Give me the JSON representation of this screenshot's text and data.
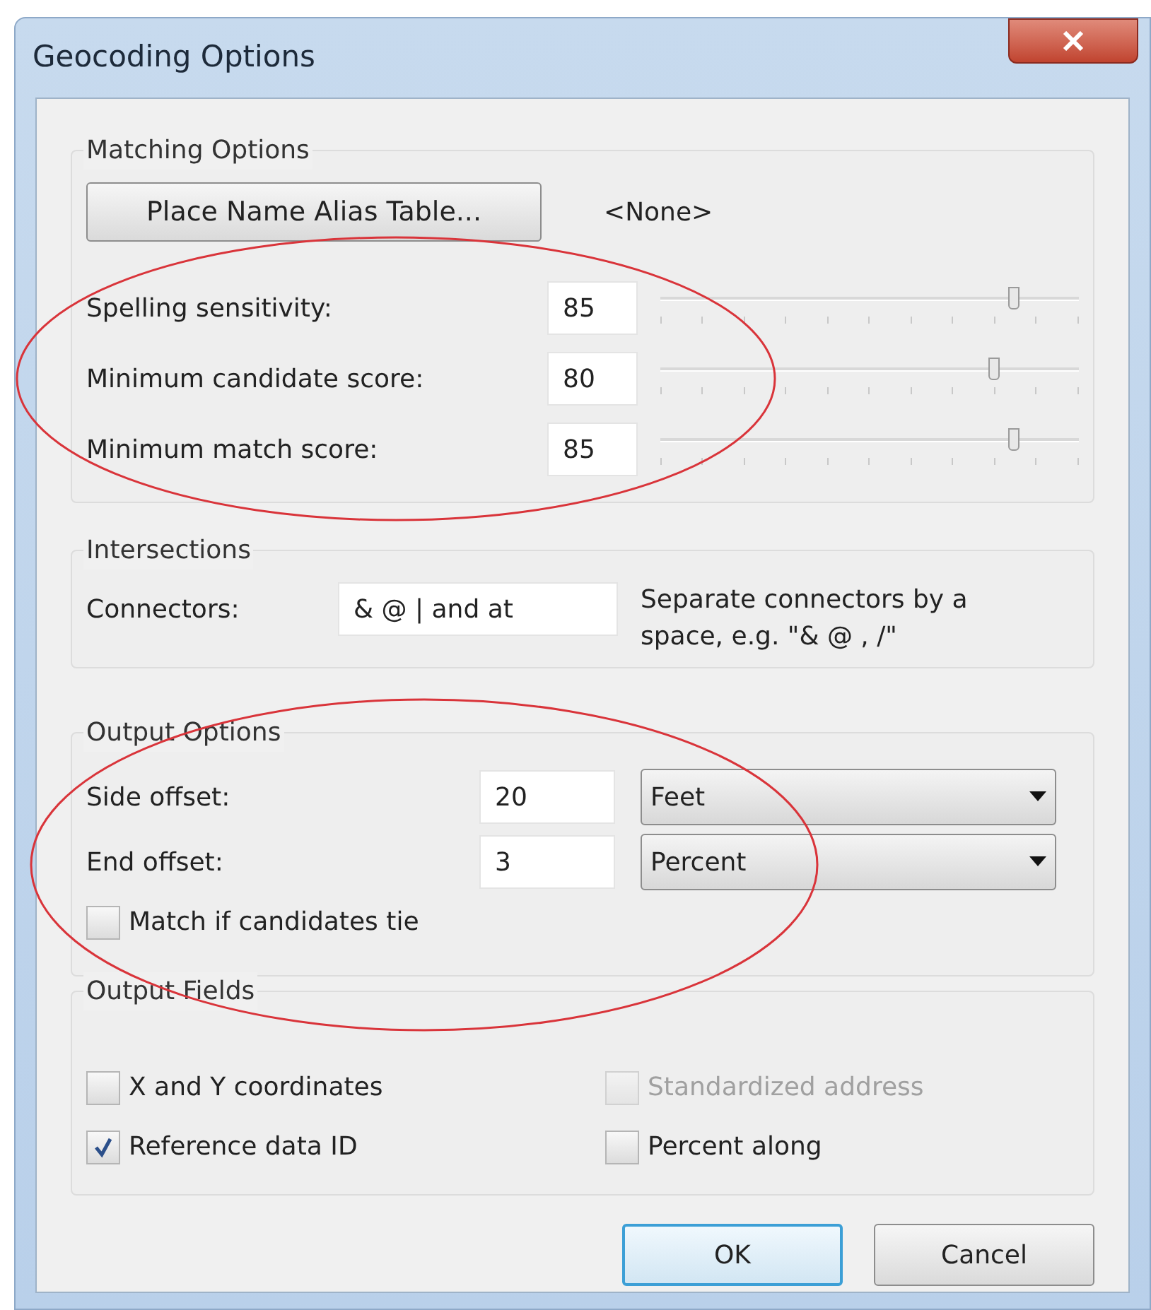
{
  "window": {
    "title": "Geocoding Options"
  },
  "matching_options": {
    "title": "Matching Options",
    "alias_button": "Place Name Alias Table...",
    "alias_value": "<None>",
    "settings": [
      {
        "label": "Spelling sensitivity:",
        "value": "85",
        "level": 0.85
      },
      {
        "label": "Minimum candidate score:",
        "value": "80",
        "level": 0.8
      },
      {
        "label": "Minimum match score:",
        "value": "85",
        "level": 0.85
      }
    ]
  },
  "intersections": {
    "title": "Intersections",
    "label": "Connectors:",
    "value": "& @ | and at",
    "hint": "Separate connectors by a space, e.g. \"& @ , /\""
  },
  "output_options": {
    "title": "Output Options",
    "offsets": [
      {
        "label": "Side offset:",
        "value": "20",
        "unit": "Feet"
      },
      {
        "label": "End offset:",
        "value": "3",
        "unit": "Percent"
      }
    ],
    "tie": {
      "label": "Match if candidates tie",
      "checked": false
    }
  },
  "output_fields": {
    "title": "Output Fields",
    "fields": [
      {
        "label": "X and Y coordinates",
        "checked": false,
        "disabled": false
      },
      {
        "label": "Standardized address",
        "checked": false,
        "disabled": true
      },
      {
        "label": "Reference data ID",
        "checked": true,
        "disabled": false
      },
      {
        "label": "Percent along",
        "checked": false,
        "disabled": false
      }
    ]
  },
  "buttons": [
    {
      "label": "OK",
      "default": true
    },
    {
      "label": "Cancel",
      "default": false
    }
  ]
}
